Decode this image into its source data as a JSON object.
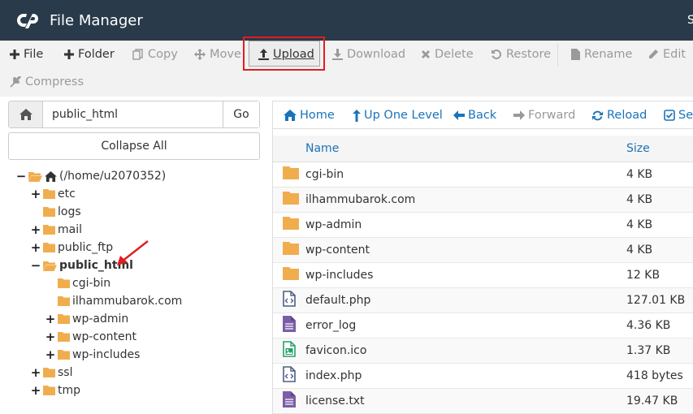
{
  "header": {
    "title": "File Manager",
    "right_text": "S"
  },
  "toolbar": {
    "file": "File",
    "folder": "Folder",
    "copy": "Copy",
    "move": "Move",
    "upload": "Upload",
    "download": "Download",
    "delete": "Delete",
    "restore": "Restore",
    "rename": "Rename",
    "edit": "Edit",
    "compress": "Compress"
  },
  "left": {
    "path_value": "public_html",
    "go_label": "Go",
    "collapse_label": "Collapse All",
    "tree": {
      "root": "(/home/u2070352)",
      "etc": "etc",
      "logs": "logs",
      "mail": "mail",
      "public_ftp": "public_ftp",
      "public_html": "public_html",
      "cgi_bin": "cgi-bin",
      "ilhammubarok": "ilhammubarok.com",
      "wp_admin": "wp-admin",
      "wp_content": "wp-content",
      "wp_includes": "wp-includes",
      "ssl": "ssl",
      "tmp": "tmp"
    }
  },
  "nav": {
    "home": "Home",
    "up": "Up One Level",
    "back": "Back",
    "forward": "Forward",
    "reload": "Reload",
    "select": "Sele"
  },
  "table": {
    "headers": {
      "name": "Name",
      "size": "Size"
    },
    "rows": [
      {
        "name": "cgi-bin",
        "size": "4 KB",
        "icon": "folder-icon"
      },
      {
        "name": "ilhammubarok.com",
        "size": "4 KB",
        "icon": "folder-icon"
      },
      {
        "name": "wp-admin",
        "size": "4 KB",
        "icon": "folder-icon"
      },
      {
        "name": "wp-content",
        "size": "4 KB",
        "icon": "folder-icon"
      },
      {
        "name": "wp-includes",
        "size": "12 KB",
        "icon": "folder-icon"
      },
      {
        "name": "default.php",
        "size": "127.01 KB",
        "icon": "code-file-icon"
      },
      {
        "name": "error_log",
        "size": "4.36 KB",
        "icon": "text-file-icon"
      },
      {
        "name": "favicon.ico",
        "size": "1.37 KB",
        "icon": "image-file-icon"
      },
      {
        "name": "index.php",
        "size": "418 bytes",
        "icon": "code-file-icon"
      },
      {
        "name": "license.txt",
        "size": "19.47 KB",
        "icon": "text-file-icon"
      }
    ]
  },
  "colors": {
    "header_bg": "#293a4a",
    "toolbar_bg": "#f2f2f2",
    "link_blue": "#1a73b9",
    "folder_yellow": "#f0ad4e",
    "highlight_red": "#e21c21"
  }
}
